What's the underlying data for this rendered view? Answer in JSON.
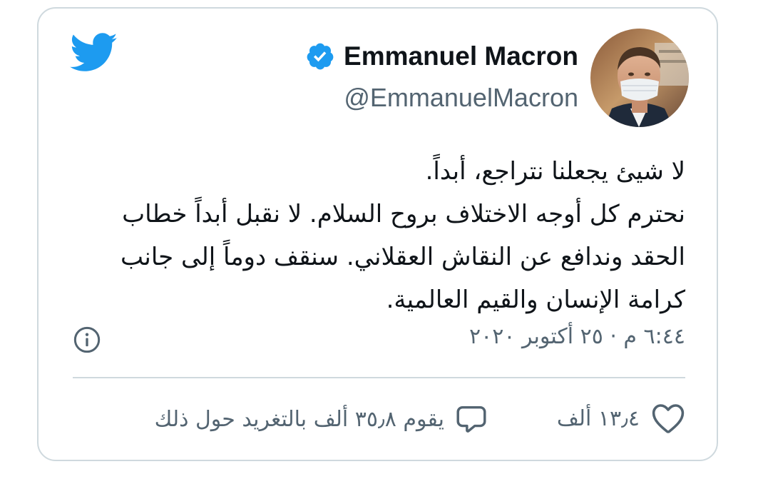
{
  "author": {
    "display_name": "Emmanuel Macron",
    "handle": "@EmmanuelMacron",
    "verified": true,
    "avatar": "person-photo"
  },
  "tweet": {
    "lines": [
      "لا شيئ يجعلنا نتراجع، أبداً.",
      "نحترم كل أوجه الاختلاف بروح السلام. لا نقبل أبداً خطاب",
      "الحقد وندافع عن النقاش العقلاني. سنقف دوماً إلى جانب",
      "كرامة الإنسان والقيم العالمية."
    ],
    "timestamp": "٦:٤٤ م · ٢٥ أكتوبر ٢٠٢٠"
  },
  "actions": {
    "like_count": "١٣٫٤ ألف",
    "reply_label": "يقوم ٣٥٫٨ ألف بالتغريد حول ذلك"
  },
  "icons": {
    "logo": "twitter-bird-icon",
    "verified": "verified-badge-icon",
    "info": "info-icon",
    "like": "heart-icon",
    "reply": "speech-bubble-icon"
  },
  "colors": {
    "brand_blue": "#1d9bf0",
    "text_primary": "#0f1419",
    "text_secondary": "#536471",
    "border": "#cfd9de"
  }
}
